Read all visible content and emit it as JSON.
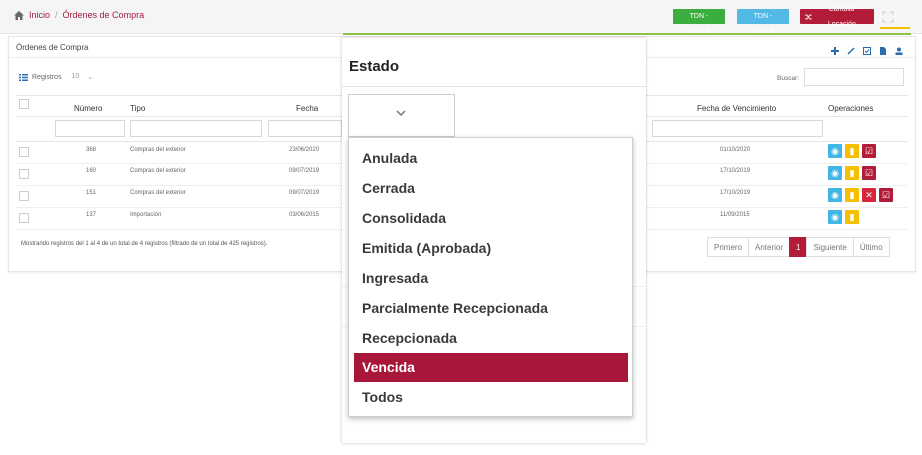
{
  "breadcrumb": {
    "home": "Inicio",
    "separator": "/",
    "current": "Órdenes de Compra"
  },
  "badges": {
    "location1": "TDN - Central",
    "location2": "TDN - Central",
    "change_location": "Cambiar Locación"
  },
  "panel": {
    "title": "Órdenes de Compra"
  },
  "table_controls": {
    "registros_label": "Registros",
    "page_size": "10",
    "search_label": "Buscar:",
    "search_value": ""
  },
  "columns": {
    "numero": "Número",
    "tipo": "Tipo",
    "fecha": "Fecha",
    "vencimiento": "Fecha de Vencimiento",
    "operaciones": "Operaciones"
  },
  "rows": [
    {
      "numero": "368",
      "tipo": "Compras del exterior",
      "fecha": "23/06/2020",
      "vencimiento": "01/10/2020"
    },
    {
      "numero": "160",
      "tipo": "Compras del exterior",
      "fecha": "09/07/2019",
      "vencimiento": "17/10/2019"
    },
    {
      "numero": "151",
      "tipo": "Compras del exterior",
      "fecha": "09/07/2019",
      "vencimiento": "17/10/2019"
    },
    {
      "numero": "137",
      "tipo": "Importación",
      "fecha": "03/06/2015",
      "vencimiento": "11/09/2015"
    }
  ],
  "footer": {
    "summary": "Mostrando registros del 1 al 4 de un total de 4 registros (filtrado de un total de 425 registros)."
  },
  "pagination": {
    "first": "Primero",
    "prev": "Anterior",
    "current": "1",
    "next": "Siguiente",
    "last": "Último"
  },
  "modal": {
    "title": "Estado",
    "selected_value": ""
  },
  "dropdown": {
    "options": [
      "Anulada",
      "Cerrada",
      "Consolidada",
      "Emitida (Aprobada)",
      "Ingresada",
      "Parcialmente Recepcionada",
      "Recepcionada",
      "Vencida",
      "Todos"
    ],
    "highlighted": "Vencida"
  },
  "colors": {
    "brand": "#b31c39",
    "green": "#3cae3f",
    "blue": "#52b8e6",
    "yellow": "#f6c000"
  }
}
